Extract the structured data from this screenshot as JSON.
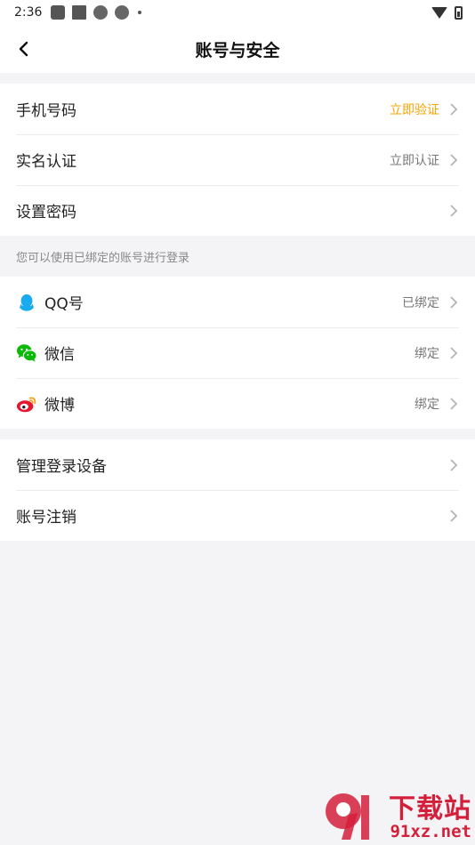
{
  "status_bar": {
    "time": "2:36"
  },
  "nav": {
    "title": "账号与安全"
  },
  "group1": [
    {
      "label": "手机号码",
      "value": "立即验证"
    },
    {
      "label": "实名认证",
      "value": "立即认证"
    },
    {
      "label": "设置密码",
      "value": ""
    }
  ],
  "hint": "您可以使用已绑定的账号进行登录",
  "group2": [
    {
      "label": "QQ号",
      "value": "已绑定",
      "icon": "qq-icon"
    },
    {
      "label": "微信",
      "value": "绑定",
      "icon": "wechat-icon"
    },
    {
      "label": "微博",
      "value": "绑定",
      "icon": "weibo-icon"
    }
  ],
  "group3": [
    {
      "label": "管理登录设备"
    },
    {
      "label": "账号注销"
    }
  ],
  "watermark": {
    "brand": "下载站",
    "url": "91xz.net"
  },
  "colors": {
    "accent": "#f5a300",
    "qq": "#1aabee",
    "wechat": "#09bb07",
    "weibo": "#e6162d"
  }
}
